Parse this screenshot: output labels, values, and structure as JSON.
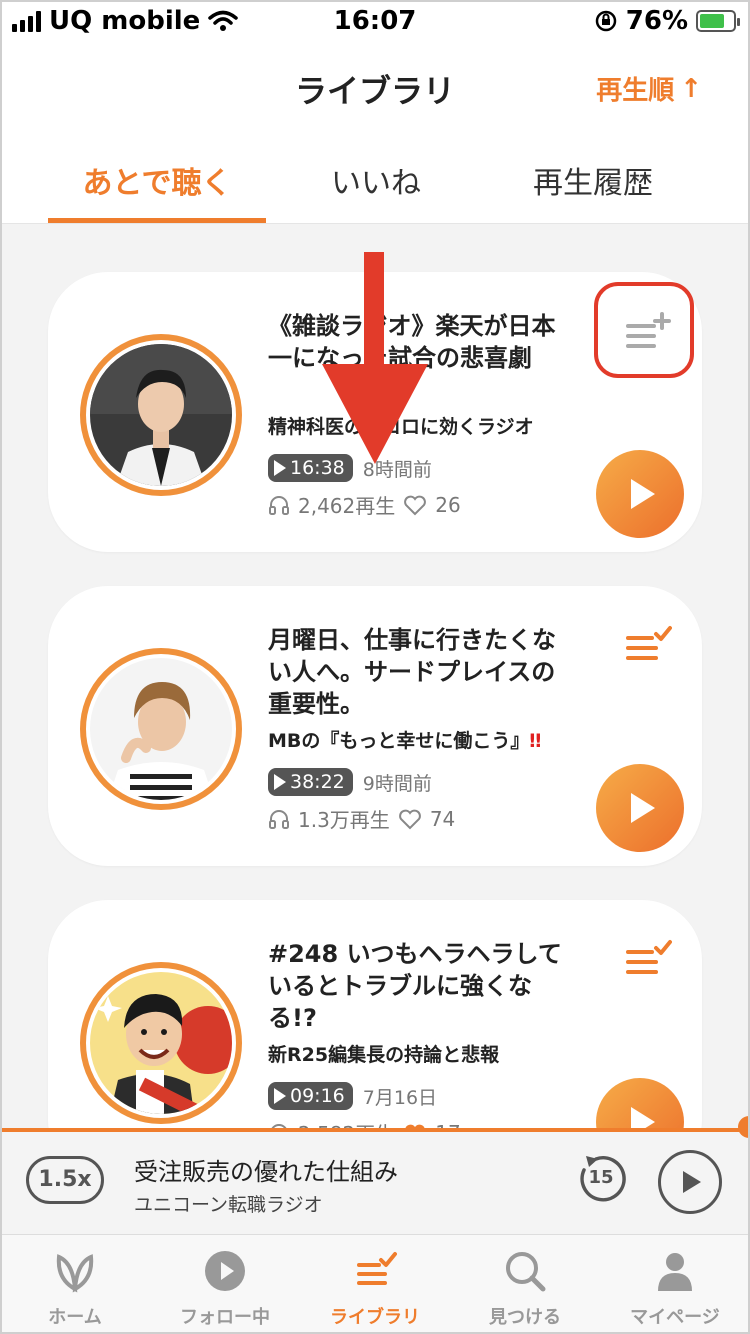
{
  "status_bar": {
    "carrier": "UQ mobile",
    "time": "16:07",
    "battery": "76%"
  },
  "header": {
    "title": "ライブラリ",
    "sort_label": "再生順",
    "sort_arrow": "↑"
  },
  "tabs": [
    {
      "label": "あとで聴く",
      "active": true
    },
    {
      "label": "いいね",
      "active": false
    },
    {
      "label": "再生履歴",
      "active": false
    }
  ],
  "episodes": [
    {
      "title": "《雑談ラジオ》楽天が日本一になった試合の悲喜劇",
      "show": "精神科医のココロに効くラジオ",
      "duration": "16:38",
      "posted": "8時間前",
      "plays": "2,462再生",
      "likes": "26",
      "queued": false
    },
    {
      "title": "月曜日、仕事に行きたくない人へ。サードプレイスの重要性。",
      "show": "MBの『もっと幸せに働こう』",
      "show_badge": "‼",
      "duration": "38:22",
      "posted": "9時間前",
      "plays": "1.3万再生",
      "likes": "74",
      "queued": true
    },
    {
      "title": "#248 いつもヘラヘラしているとトラブルに強くなる!?",
      "show": "新R25編集長の持論と悲報",
      "duration": "09:16",
      "posted": "7月16日",
      "plays": "2,582再生",
      "likes": "17",
      "queued": true
    }
  ],
  "now_playing": {
    "speed": "1.5x",
    "title": "受注販売の優れた仕組み",
    "show": "ユニコーン転職ラジオ",
    "skip_seconds": "15"
  },
  "nav": [
    {
      "label": "ホーム",
      "icon": "leaf-icon",
      "active": false
    },
    {
      "label": "フォロー中",
      "icon": "play-circle-icon",
      "active": false
    },
    {
      "label": "ライブラリ",
      "icon": "library-icon",
      "active": true
    },
    {
      "label": "見つける",
      "icon": "search-icon",
      "active": false
    },
    {
      "label": "マイページ",
      "icon": "person-icon",
      "active": false
    }
  ],
  "colors": {
    "accent": "#ef7d2d",
    "annotation_red": "#e23b2a"
  }
}
